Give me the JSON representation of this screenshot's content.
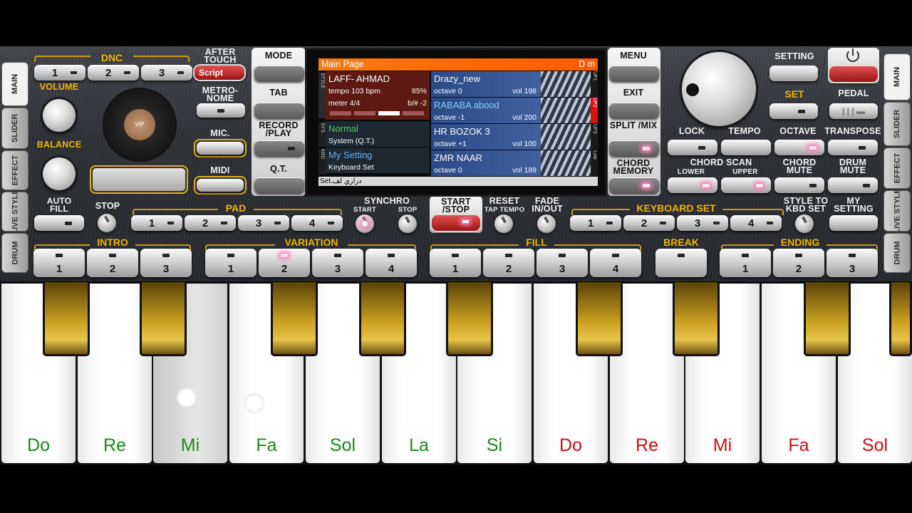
{
  "side_tabs_left": [
    "MAIN",
    "SLIDER",
    "EFFECT",
    "LIVE STYLE",
    "DRUM"
  ],
  "side_tabs_right": [
    "MAIN",
    "SLIDER",
    "EFFECT",
    "LIVE STYLE",
    "DRUM"
  ],
  "dnc": {
    "label": "DNC",
    "buttons": [
      "1",
      "2",
      "3"
    ],
    "script_label": "Script"
  },
  "left_labels": {
    "volume": "VOLUME",
    "balance": "BALANCE",
    "auto_fill": "AUTO FILL",
    "after_touch": "AFTER TOUCH",
    "metronome": "METRO-NOME",
    "mic": "MIC.",
    "midi": "MIDI",
    "vip_logo": "VIP"
  },
  "center_buttons": {
    "mode": "MODE",
    "tab": "TAB",
    "record_play": "RECORD /PLAY",
    "qt": "Q.T.",
    "menu": "MENU",
    "exit": "EXIT",
    "split_mix": "SPLIT /MIX",
    "chord_memory": "CHORD MEMORY"
  },
  "screen": {
    "title": "Main Page",
    "key": "D m",
    "strip1": "STYLE",
    "strip2": "SYS",
    "strip3": "KBD",
    "style_name": "LAFF- AHMAD",
    "tempo": "tempo 103 bpm",
    "tempo_pct": "85%",
    "meter": "meter 4/4",
    "transpose": "b/# -2",
    "sys_name": "Normal",
    "sys_sub": "System (Q.T.)",
    "kbd_name": "My Setting",
    "kbd_sub": "Keyboard Set",
    "footer": "Set.دراري لف",
    "upper_labels": [
      "UP1",
      "UP2",
      "UP3",
      "Low"
    ],
    "voices": [
      {
        "name": "Drazy_new",
        "octave": "octave  0",
        "vol": "vol 198"
      },
      {
        "name": "RABABA abood",
        "octave": "octave  -1",
        "vol": "vol 200"
      },
      {
        "name": "HR BOZOK 3",
        "octave": "octave  +1",
        "vol": "vol 100"
      },
      {
        "name": "ZMR NAAR",
        "octave": "octave  0",
        "vol": "vol 189"
      }
    ]
  },
  "right_labels": {
    "setting": "SETTING",
    "set": "SET",
    "pedal": "PEDAL",
    "lock": "LOCK",
    "tempo": "TEMPO",
    "octave": "OCTAVE",
    "transpose": "TRANSPOSE",
    "chord_scan": "CHORD SCAN",
    "lower": "LOWER",
    "upper": "UPPER",
    "chord_mute": "CHORD MUTE",
    "drum_mute": "DRUM MUTE",
    "style_to_kbd": "STYLE TO KBD SET",
    "my_setting": "MY SETTING"
  },
  "row3": {
    "stop": "STOP",
    "pad": "PAD",
    "pad_buttons": [
      "1",
      "2",
      "3",
      "4"
    ],
    "synchro": "SYNCHRO",
    "synchro_start": "START",
    "synchro_stop": "STOP",
    "start_stop": "START /STOP",
    "reset": "RESET",
    "tap_tempo": "TAP TEMPO",
    "fade": "FADE IN/OUT",
    "keyboard_set": "KEYBOARD SET",
    "kbd_buttons": [
      "1",
      "2",
      "3",
      "4"
    ]
  },
  "row4": {
    "intro": "INTRO",
    "intro_buttons": [
      "1",
      "2",
      "3"
    ],
    "variation": "VARIATION",
    "variation_buttons": [
      "1",
      "2",
      "3",
      "4"
    ],
    "fill": "FILL",
    "fill_buttons": [
      "1",
      "2",
      "3",
      "4"
    ],
    "break": "BREAK",
    "ending": "ENDING",
    "ending_buttons": [
      "1",
      "2",
      "3"
    ]
  },
  "keyboard": {
    "white_notes": [
      "Do",
      "Re",
      "Mi",
      "Fa",
      "Sol",
      "La",
      "Si",
      "Do",
      "Re",
      "Mi",
      "Fa",
      "Sol"
    ],
    "note_colors": [
      "#1a8a1a",
      "#1a8a1a",
      "#1a8a1a",
      "#1a8a1a",
      "#1a8a1a",
      "#1a8a1a",
      "#1a8a1a",
      "#cc1010",
      "#cc1010",
      "#cc1010",
      "#cc1010",
      "#cc1010"
    ],
    "pressed_key": "Mi"
  }
}
